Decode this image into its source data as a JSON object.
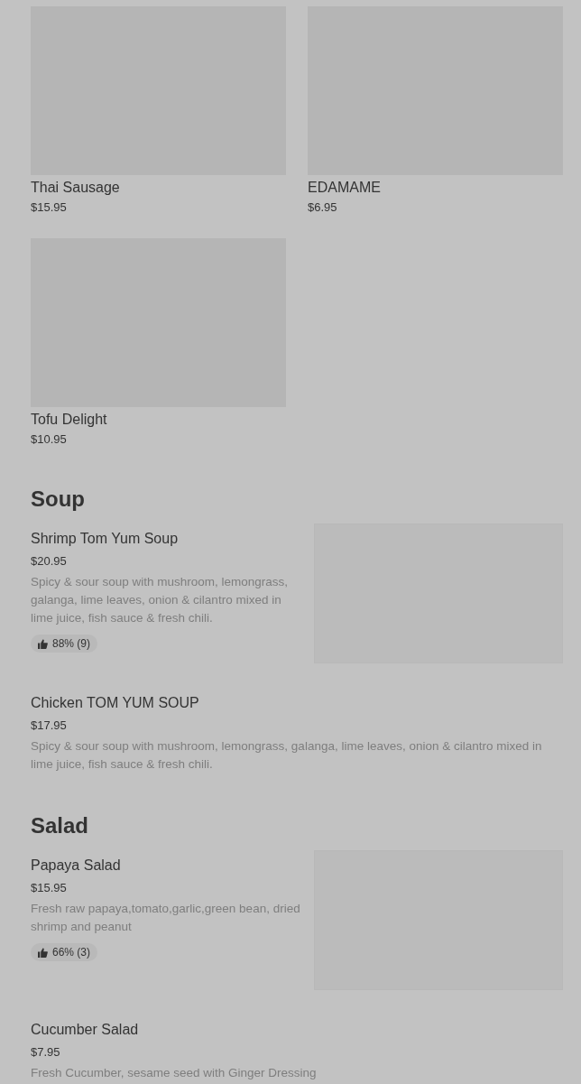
{
  "grid_items": [
    {
      "name": "Thai Sausage",
      "price": "$15.95",
      "kind": "picture"
    },
    {
      "name": "EDAMAME",
      "price": "$6.95",
      "kind": "picture"
    },
    {
      "name": "Tofu Delight",
      "price": "$10.95",
      "kind": "picture"
    }
  ],
  "sections": [
    {
      "title": "Soup",
      "items": [
        {
          "name": "Shrimp Tom Yum Soup",
          "price": "$20.95",
          "description": "Spicy & sour soup with mushroom, lemongrass, galanga, lime leaves, onion & cilantro mixed in lime juice, fish sauce & fresh chili.",
          "rating": "88% (9)",
          "kind": "with_image"
        },
        {
          "name": "Chicken TOM YUM SOUP",
          "price": "$17.95",
          "description": "Spicy & sour soup with mushroom, lemongrass, galanga, lime leaves, onion & cilantro mixed in lime juice, fish sauce & fresh chili.",
          "kind": "text_only"
        }
      ]
    },
    {
      "title": "Salad",
      "items": [
        {
          "name": "Papaya Salad",
          "price": "$15.95",
          "description": "Fresh raw papaya,tomato,garlic,green bean, dried shrimp and peanut",
          "rating": "66% (3)",
          "kind": "with_image"
        },
        {
          "name": "Cucumber Salad",
          "price": "$7.95",
          "description": "Fresh Cucumber, sesame seed with Ginger Dressing",
          "kind": "text_only"
        }
      ]
    }
  ]
}
